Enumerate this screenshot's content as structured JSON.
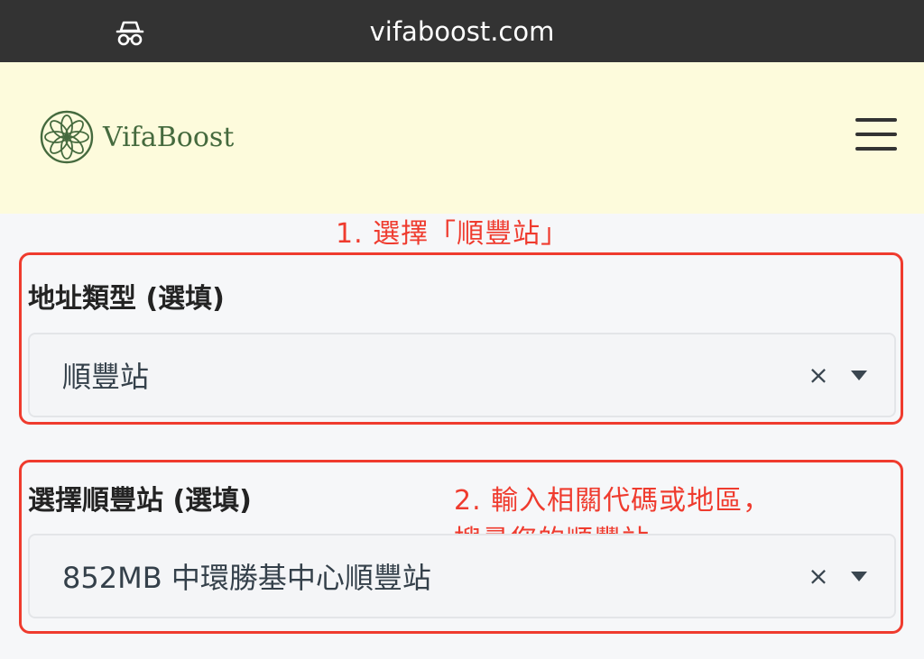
{
  "browser": {
    "url": "vifaboost.com",
    "mode_icon": "incognito-icon"
  },
  "header": {
    "logo_text": "VifaBoost",
    "logo_icon": "flower-mandala-logo",
    "menu_icon": "hamburger-menu-icon",
    "background": "#fdfbdc",
    "brand_color": "#456a3e"
  },
  "annotations": {
    "step1": "1. 選擇「順豐站」",
    "step2_line1": "2. 輸入相關代碼或地區，",
    "step2_line2": "搜尋您的順豐站",
    "color": "#ef3b2e"
  },
  "form": {
    "address_type": {
      "label": "地址類型 (選填)",
      "value": "順豐站",
      "clear_symbol": "×"
    },
    "sf_station": {
      "label": "選擇順豐站 (選填)",
      "value": "852MB 中環勝基中心順豐站",
      "clear_symbol": "×"
    }
  }
}
